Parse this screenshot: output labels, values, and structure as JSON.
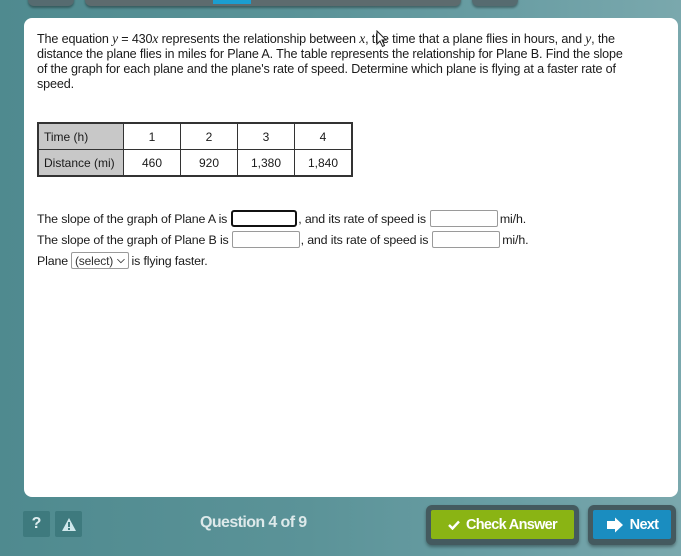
{
  "prompt": {
    "part1": "The equation ",
    "equation_y": "y",
    "equation_mid": " = 430",
    "equation_x": "x",
    "part2": " represents the relationship between ",
    "var_x": "x",
    "part3": ", the time that a plane flies in hours, and ",
    "var_y": "y",
    "part4": ", the distance the plane flies in miles for Plane A. The table represents the relationship for Plane B. Find the slope of the graph for each plane and the plane's rate of speed. Determine which plane is flying at a faster rate of speed."
  },
  "table": {
    "rows": [
      {
        "header": "Time (h)",
        "values": [
          "1",
          "2",
          "3",
          "4"
        ]
      },
      {
        "header": "Distance (mi)",
        "values": [
          "460",
          "920",
          "1,380",
          "1,840"
        ]
      }
    ]
  },
  "answers": {
    "row_a_prefix": "The slope of the graph of Plane A is",
    "row_b_prefix": "The slope of the graph of Plane B is",
    "rate_text": ", and its rate of speed is",
    "unit": "mi/h.",
    "slope_a_value": "",
    "rate_a_value": "",
    "slope_b_value": "",
    "rate_b_value": "",
    "plane_label": "Plane",
    "plane_select_value": "(select)",
    "faster_suffix": "is flying faster."
  },
  "footer": {
    "help_icon": "?",
    "warning_icon": "warning-triangle",
    "question_counter": "Question 4 of 9",
    "check_answer_label": "Check Answer",
    "next_label": "Next"
  },
  "colors": {
    "check_button": "#8ab414",
    "next_button": "#1a8dc0",
    "background": "#5b9398"
  }
}
